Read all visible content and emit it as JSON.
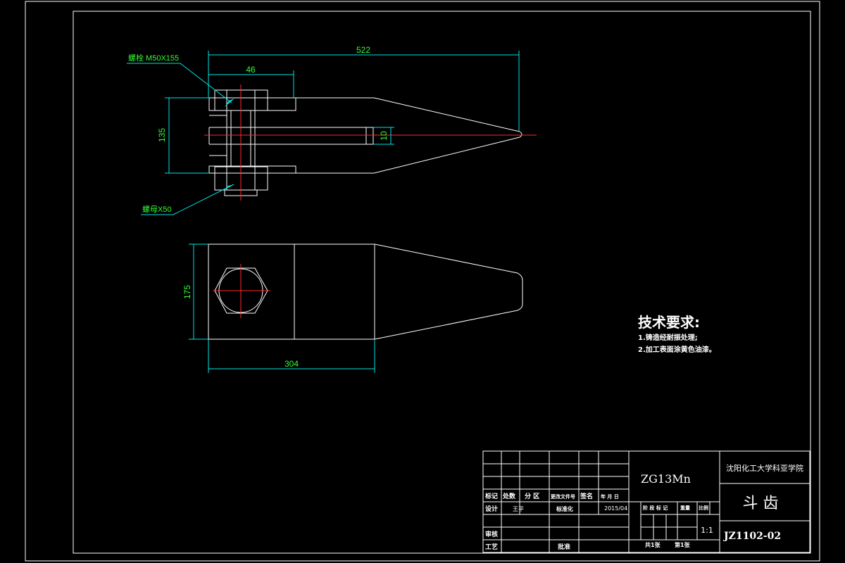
{
  "dimensions": {
    "d522": "522",
    "d46": "46",
    "d135": "135",
    "d10": "10",
    "d175": "175",
    "d304": "304"
  },
  "annotations": {
    "bolt": "螺栓 M50X155",
    "nut": "螺母X50"
  },
  "tech_requirements": {
    "title": "技术要求:",
    "items": [
      "1.铸造经耐振处理;",
      "2.加工表面涂黄色油漆。"
    ]
  },
  "title_block": {
    "headers": {
      "mark": "标记",
      "count": "处数",
      "zone": "分 区",
      "doc_no": "更改文件号",
      "sign": "签名",
      "date": "年 月 日"
    },
    "rows": {
      "design": "设计",
      "designer": "王平",
      "standard": "标准化",
      "design_date": "2015/04",
      "review": "审核",
      "process": "工艺",
      "approve": "批准"
    },
    "material": "ZG13Mn",
    "school": "沈阳化工大学科亚学院",
    "part_name": "斗 齿",
    "stage_mark": "阶 段 标 记",
    "weight": "重量",
    "scale_label": "比例",
    "scale": "1:1",
    "drawing_no": "JZ1102-02",
    "total_sheets": "共1张",
    "sheet_no": "第1张"
  }
}
